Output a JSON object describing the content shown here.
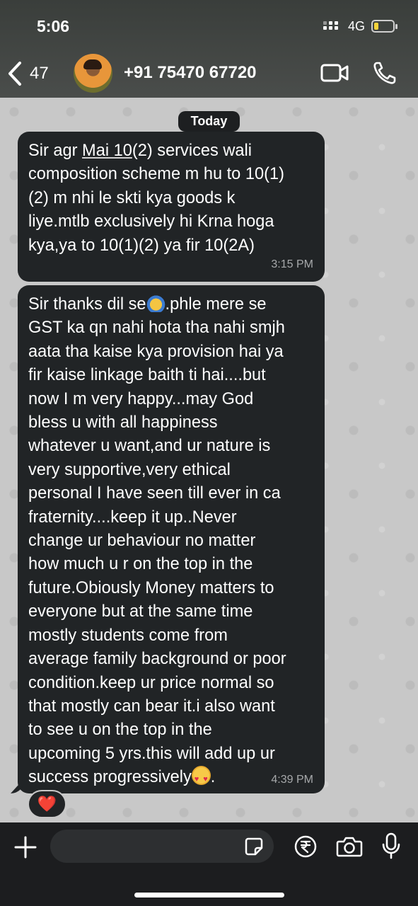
{
  "status_bar": {
    "time": "5:06",
    "network": "4G"
  },
  "header": {
    "back_count": "47",
    "contact_name": "+91 75470 67720"
  },
  "chat": {
    "date_separator": "Today",
    "messages": [
      {
        "text_before": "Sir agr ",
        "text_underlined": "Mai 10",
        "text_after": "(2) services wali\ncomposition scheme m hu to 10(1)\n(2) m nhi le skti kya goods k\nliye.mtlb exclusively hi Krna hoga\nkya,ya to 10(1)(2) ya fir 10(2A)",
        "time": "3:15 PM"
      },
      {
        "text_1": "Sir thanks dil se",
        "text_2": ".phle mere se\nGST ka qn nahi hota tha nahi smjh\naata tha kaise kya provision hai ya\nfir kaise linkage baith ti hai....but\nnow I m very happy...may God\nbless u with all happiness\nwhatever u want,and ur nature is\nvery supportive,very ethical\npersonal I have seen till ever in ca\nfraternity....keep it up..Never\nchange ur behaviour no matter\nhow much u r on the top in the\nfuture.Obiously Money matters to\neveryone but at the same time\nmostly students come from\naverage family background or poor\ncondition.keep ur price normal so\nthat mostly can bear it.i also want\nto see u on the top in the\nupcoming 5 yrs.this will add up ur\nsuccess progressively",
        "text_3": ".",
        "time": "4:39 PM",
        "reaction": "❤️"
      }
    ]
  },
  "composer": {
    "placeholder": ""
  },
  "icons": {
    "back": "chevron-left-icon",
    "video": "video-call-icon",
    "call": "phone-icon",
    "plus": "plus-icon",
    "sticker": "sticker-icon",
    "payment": "rupee-icon",
    "camera": "camera-icon",
    "mic": "microphone-icon"
  },
  "colors": {
    "bubble": "#212426",
    "header": "#3f423f",
    "wallpaper": "#c8c8c8",
    "bottom_bar": "#1c1d1f"
  }
}
